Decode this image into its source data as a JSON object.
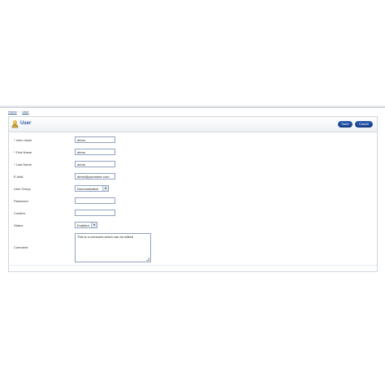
{
  "breadcrumb": {
    "home": "Home",
    "separator": "::",
    "current": "User"
  },
  "panel": {
    "title": "User",
    "icon": "user-icon",
    "save_label": "Save",
    "cancel_label": "Cancel"
  },
  "form": {
    "username": {
      "label": "* User name",
      "value": "demo"
    },
    "firstname": {
      "label": "* First Name",
      "value": "demo"
    },
    "lastname": {
      "label": "* Last Name",
      "value": "demo"
    },
    "email": {
      "label": "E-Mail",
      "value": "demo@yourstore.com"
    },
    "usergroup": {
      "label": "User Group",
      "value": "Demonstration"
    },
    "password": {
      "label": "Password",
      "value": ""
    },
    "confirm": {
      "label": "Confirm",
      "value": ""
    },
    "status": {
      "label": "Status",
      "value": "Enabled"
    },
    "comment": {
      "label": "Comment",
      "value": "This is a comment which can be edited"
    }
  },
  "colors": {
    "accent": "#2a5aa8",
    "button": "#1f4a9a",
    "border": "#8fa3bf"
  }
}
